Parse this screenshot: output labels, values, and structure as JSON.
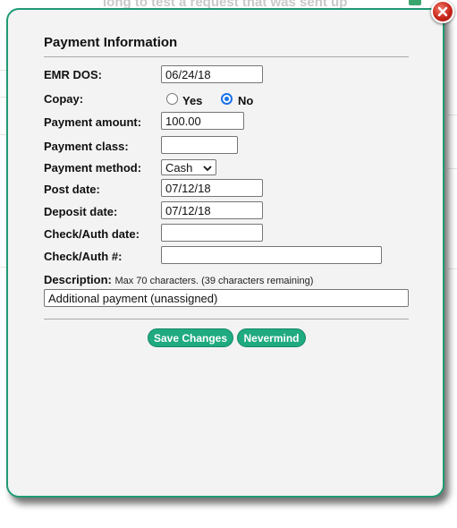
{
  "background": {
    "heading_fragment": "long to test a request that was sent up"
  },
  "dialog": {
    "title": "Payment Information",
    "fields": {
      "emr_dos": {
        "label": "EMR DOS:",
        "value": "06/24/18"
      },
      "copay": {
        "label": "Copay:",
        "options": [
          "Yes",
          "No"
        ],
        "selected": "No"
      },
      "payment_amount": {
        "label": "Payment amount:",
        "value": "100.00"
      },
      "payment_class": {
        "label": "Payment class:",
        "value": ""
      },
      "payment_method": {
        "label": "Payment method:",
        "selected": "Cash"
      },
      "post_date": {
        "label": "Post date:",
        "value": "07/12/18"
      },
      "deposit_date": {
        "label": "Deposit date:",
        "value": "07/12/18"
      },
      "check_auth_date": {
        "label": "Check/Auth date:",
        "value": ""
      },
      "check_auth_number": {
        "label": "Check/Auth #:",
        "value": ""
      }
    },
    "description": {
      "label": "Description:",
      "hint": "Max 70 characters. (39 characters remaining)",
      "value": "Additional payment (unassigned)"
    },
    "buttons": {
      "save": "Save Changes",
      "cancel": "Nevermind"
    }
  },
  "colors": {
    "accent": "#1faa80",
    "border": "#1f9a74",
    "close": "#c8261a",
    "radio_selected": "#1a73e8"
  },
  "icons": {
    "close": "close-icon",
    "dropdown": "chevron-down-icon"
  }
}
